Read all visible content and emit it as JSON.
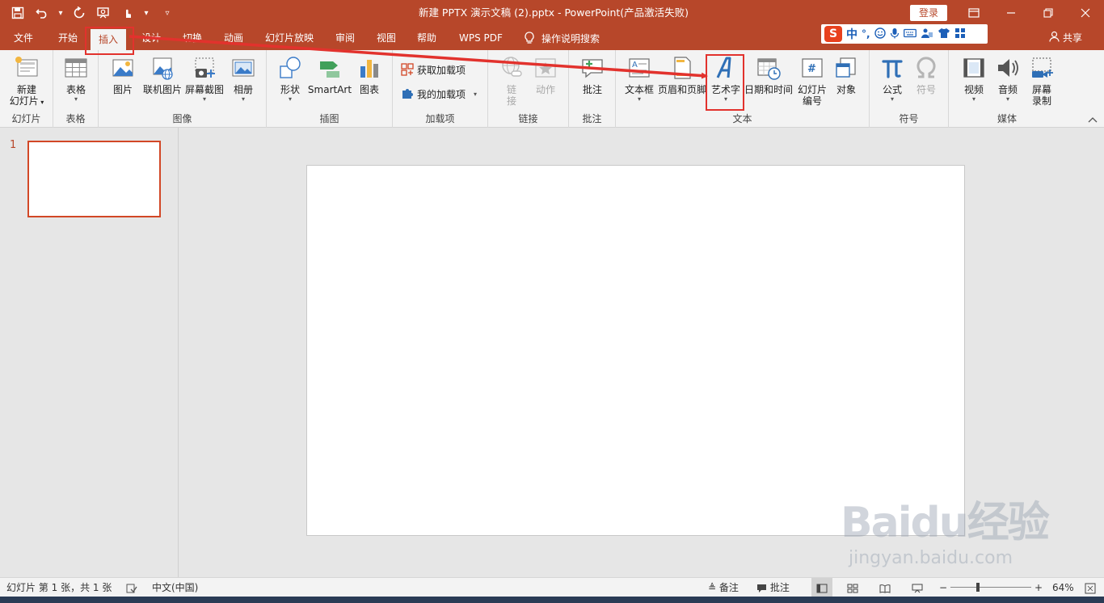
{
  "title_bar": {
    "document_title": "新建 PPTX 演示文稿 (2).pptx  -  PowerPoint(产品激活失败)",
    "login_label": "登录",
    "qat_icons": [
      "save-icon",
      "undo-icon",
      "redo-icon",
      "present-icon",
      "touch-icon",
      "customize-icon"
    ]
  },
  "tabs": [
    {
      "label": "文件"
    },
    {
      "label": "开始"
    },
    {
      "label": "插入"
    },
    {
      "label": "设计"
    },
    {
      "label": "切换"
    },
    {
      "label": "动画"
    },
    {
      "label": "幻灯片放映"
    },
    {
      "label": "审阅"
    },
    {
      "label": "视图"
    },
    {
      "label": "帮助"
    },
    {
      "label": "WPS PDF"
    }
  ],
  "tell_me": "操作说明搜索",
  "ime": {
    "mode": "中"
  },
  "share_label": "共享",
  "ribbon": {
    "groups": {
      "slides": "幻灯片",
      "tables": "表格",
      "images": "图像",
      "illustrations": "插图",
      "addins": "加载项",
      "links": "链接",
      "comments": "批注",
      "text": "文本",
      "symbols": "符号",
      "media": "媒体"
    },
    "buttons": {
      "new_slide_1": "新建",
      "new_slide_2": "幻灯片",
      "table": "表格",
      "picture": "图片",
      "online_pictures": "联机图片",
      "screenshot": "屏幕截图",
      "album": "相册",
      "shapes": "形状",
      "smartart": "SmartArt",
      "chart": "图表",
      "get_addins": "获取加载项",
      "my_addins": "我的加载项",
      "link_1": "链",
      "link_2": "接",
      "action": "动作",
      "comment": "批注",
      "textbox": "文本框",
      "header_footer": "页眉和页脚",
      "wordart": "艺术字",
      "date_time": "日期和时间",
      "slide_number_1": "幻灯片",
      "slide_number_2": "编号",
      "object": "对象",
      "equation": "公式",
      "symbol": "符号",
      "video": "视频",
      "audio": "音频",
      "screen_recording_1": "屏幕",
      "screen_recording_2": "录制"
    }
  },
  "thumbnails": [
    {
      "number": "1"
    }
  ],
  "status_bar": {
    "slide_info": "幻灯片 第 1 张，共 1 张",
    "language": "中文(中国)",
    "notes": "备注",
    "comments": "批注",
    "zoom": "64%",
    "zoom_fraction": 0.32
  },
  "watermark": {
    "brand": "Baidu经验",
    "url": "jingyan.baidu.com"
  },
  "colors": {
    "accent": "#b7472a",
    "highlight": "#e2322d",
    "icon_blue": "#2f6fb6"
  }
}
